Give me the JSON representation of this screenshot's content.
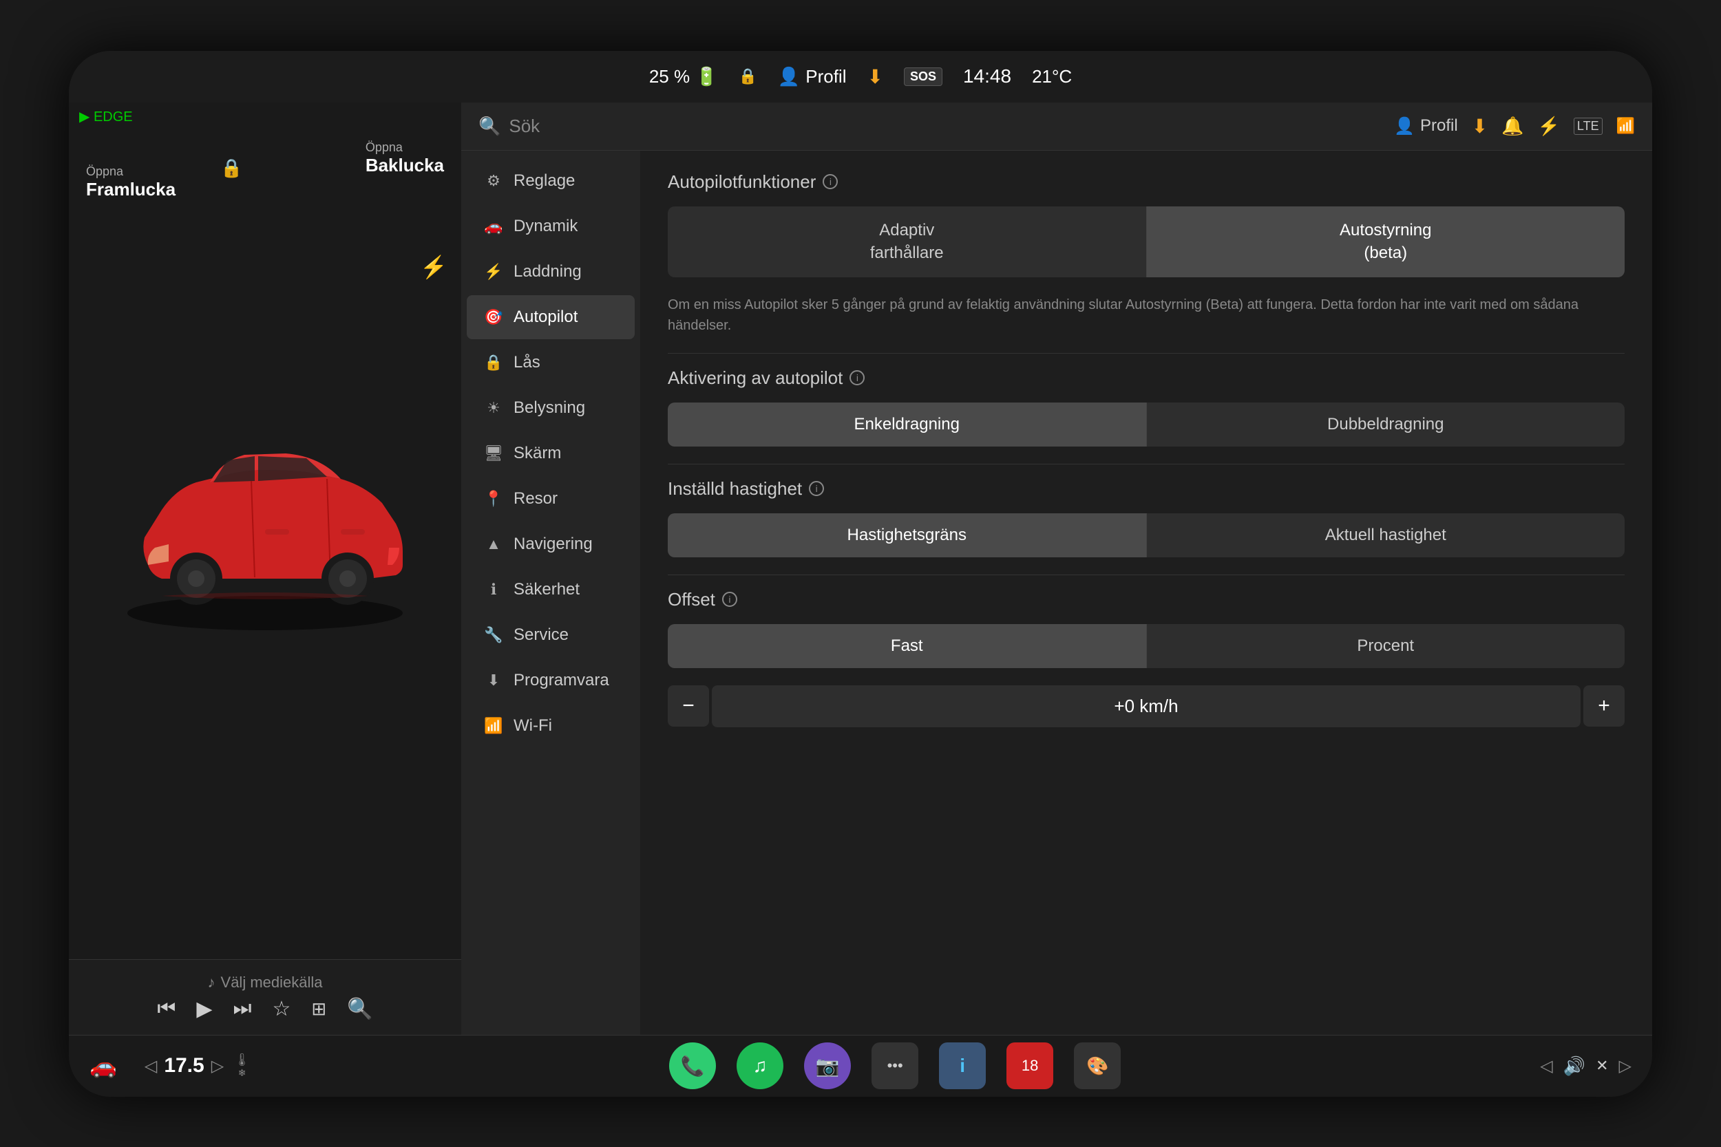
{
  "statusBar": {
    "battery": "25 %",
    "profile": "Profil",
    "download_icon": "⬇",
    "sos": "SOS",
    "time": "14:48",
    "temp": "21°C",
    "lte": "LTE"
  },
  "leftPanel": {
    "edgeIndicator": "EDGE",
    "frontDoor": {
      "label": "Öppna",
      "main": "Framlucka"
    },
    "backDoor": {
      "label": "Öppna",
      "main": "Baklucka"
    },
    "mediaBar": {
      "source": "Välj mediekälla",
      "controls": [
        "⏮",
        "▶",
        "⏭",
        "☆",
        "⊞",
        "⌕"
      ]
    }
  },
  "searchBar": {
    "placeholder": "Sök",
    "profile": "Profil",
    "download": "⬇",
    "bell": "🔔",
    "bluetooth": "⚡",
    "lte": "LTE"
  },
  "navMenu": {
    "items": [
      {
        "id": "reglage",
        "label": "Reglage",
        "icon": "⚙"
      },
      {
        "id": "dynamik",
        "label": "Dynamik",
        "icon": "🚗"
      },
      {
        "id": "laddning",
        "label": "Laddning",
        "icon": "⚡"
      },
      {
        "id": "autopilot",
        "label": "Autopilot",
        "icon": "🎯",
        "active": true
      },
      {
        "id": "las",
        "label": "Lås",
        "icon": "🔒"
      },
      {
        "id": "belysning",
        "label": "Belysning",
        "icon": "☀"
      },
      {
        "id": "skarm",
        "label": "Skärm",
        "icon": "🖥"
      },
      {
        "id": "resor",
        "label": "Resor",
        "icon": "📍"
      },
      {
        "id": "navigering",
        "label": "Navigering",
        "icon": "▲"
      },
      {
        "id": "sakerhet",
        "label": "Säkerhet",
        "icon": "ℹ"
      },
      {
        "id": "service",
        "label": "Service",
        "icon": "🔧"
      },
      {
        "id": "programvara",
        "label": "Programvara",
        "icon": "⬇"
      },
      {
        "id": "wifi",
        "label": "Wi-Fi",
        "icon": "📶"
      }
    ]
  },
  "autopilotSettings": {
    "functionsTitle": "Autopilotfunktioner",
    "buttons": [
      {
        "id": "adaptive",
        "label": "Adaptiv\nfarthållare",
        "active": false
      },
      {
        "id": "autostyrning",
        "label": "Autostyrning\n(beta)",
        "active": true
      }
    ],
    "warningText": "Om en miss Autopilot sker 5 gånger på grund av felaktig användning slutar Autostyrning (Beta) att fungera. Detta fordon har inte varit med om sådana händelser.",
    "activationTitle": "Aktivering av autopilot",
    "activationButtons": [
      {
        "id": "enkeldragning",
        "label": "Enkeldragning",
        "active": true
      },
      {
        "id": "dubbeldragning",
        "label": "Dubbeldragning",
        "active": false
      }
    ],
    "speedTitle": "Inställd hastighet",
    "speedButtons": [
      {
        "id": "hastighetsgrans",
        "label": "Hastighetsgräns",
        "active": true
      },
      {
        "id": "aktuell",
        "label": "Aktuell hastighet",
        "active": false
      }
    ],
    "offsetTitle": "Offset",
    "offsetButtons": [
      {
        "id": "fast",
        "label": "Fast",
        "active": true
      },
      {
        "id": "procent",
        "label": "Procent",
        "active": false
      }
    ],
    "offsetValue": "+0 km/h",
    "offsetMinus": "−",
    "offsetPlus": "+"
  },
  "taskbar": {
    "carIcon": "🚗",
    "speedLeft": "◁",
    "speed": "17.5",
    "speedRight": "▷",
    "phone": "📞",
    "spotify": "♫",
    "camera": "📷",
    "more": "•••",
    "info": "i",
    "calendar": "18",
    "emoji": "🎨",
    "volumeLeft": "◁",
    "volume": "🔊",
    "volumeMute": "✕",
    "volumeRight": "▷"
  }
}
